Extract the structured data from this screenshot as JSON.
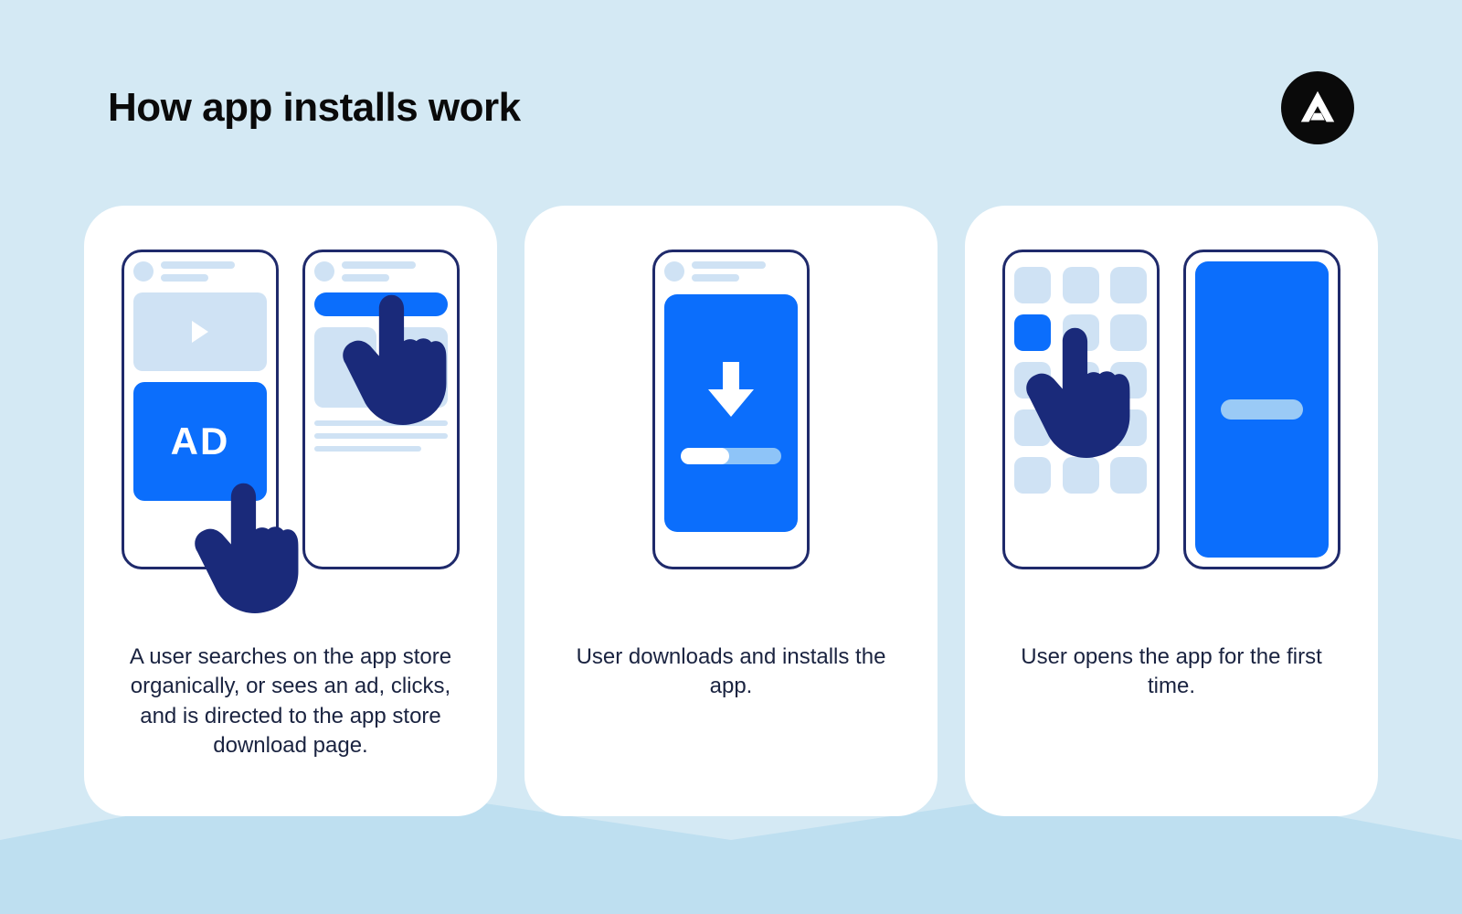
{
  "title": "How app installs work",
  "logo_alt": "Adjust logo",
  "steps": [
    {
      "caption": "A user searches on the app store organically, or sees an ad, clicks, and is directed to the app store download page.",
      "ad_label": "AD"
    },
    {
      "caption": "User downloads and installs the app."
    },
    {
      "caption": "User opens the app for the first time."
    }
  ],
  "colors": {
    "background": "#d4e9f4",
    "card": "#ffffff",
    "accent": "#0b6efc",
    "dark_accent": "#1a2a7a",
    "placeholder": "#cfe2f4",
    "text": "#1a2340"
  }
}
